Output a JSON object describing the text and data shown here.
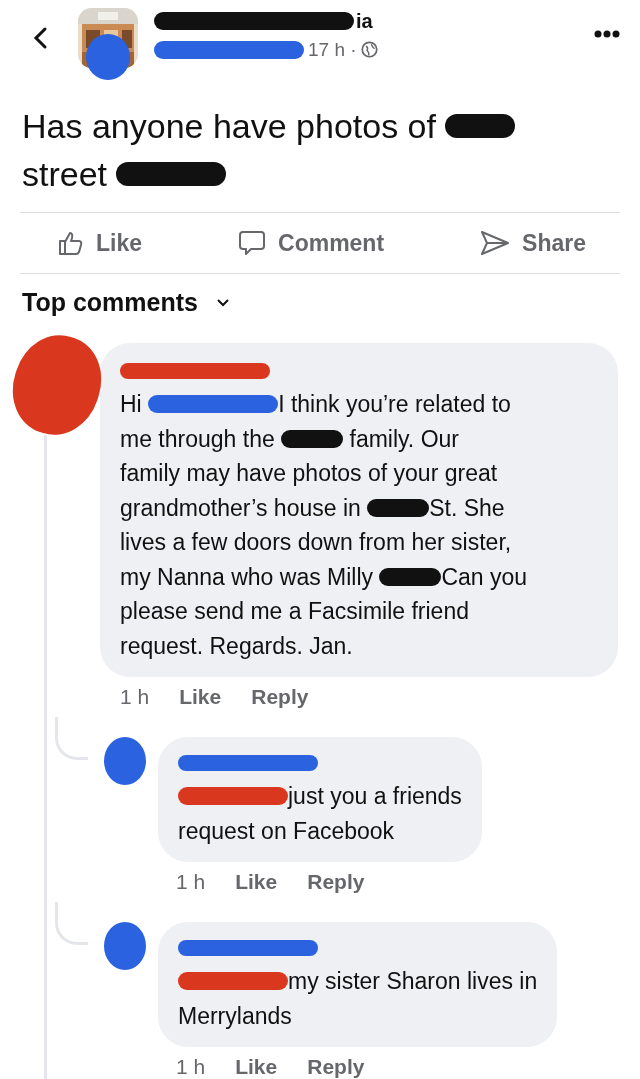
{
  "post": {
    "author": [
      {
        "kind": "redaction",
        "color": "#111111"
      },
      {
        "kind": "text",
        "text": "ia"
      }
    ],
    "time": "17 h ·",
    "lines": [
      [
        {
          "kind": "text",
          "text": "Has anyone have photos of "
        },
        {
          "kind": "redaction",
          "color": "#111111"
        }
      ],
      [
        {
          "kind": "text",
          "text": "street "
        },
        {
          "kind": "redaction",
          "color": "#111111"
        }
      ]
    ]
  },
  "actions": [
    {
      "label": "Like"
    },
    {
      "label": "Comment"
    },
    {
      "label": "Share"
    }
  ],
  "comments_header": {
    "label": "Top comments"
  },
  "comments": [
    {
      "lines": [
        [
          {
            "kind": "text",
            "text": "Hi "
          },
          {
            "kind": "redaction",
            "color": "#2a62e0"
          },
          {
            "kind": "text",
            "text": "I think you’re related to"
          }
        ],
        [
          {
            "kind": "text",
            "text": "me through the "
          },
          {
            "kind": "redaction",
            "color": "#111111"
          },
          {
            "kind": "text",
            "text": " family. Our"
          }
        ],
        [
          {
            "kind": "text",
            "text": "family may have photos of your great"
          }
        ],
        [
          {
            "kind": "text",
            "text": "grandmother’s house in "
          },
          {
            "kind": "redaction",
            "color": "#111111"
          },
          {
            "kind": "text",
            "text": "St. She"
          }
        ],
        [
          {
            "kind": "text",
            "text": "lives a few doors down from her sister,"
          }
        ],
        [
          {
            "kind": "text",
            "text": "my Nanna who was Milly "
          },
          {
            "kind": "redaction",
            "color": "#111111"
          },
          {
            "kind": "text",
            "text": "Can you"
          }
        ],
        [
          {
            "kind": "text",
            "text": "please send me a Facsimile friend"
          }
        ],
        [
          {
            "kind": "text",
            "text": "request. Regards. Jan."
          }
        ]
      ],
      "time": "1 h",
      "like": "Like",
      "reply": "Reply",
      "replies": [
        {
          "lines": [
            [
              {
                "kind": "redaction",
                "color": "#d9381e"
              },
              {
                "kind": "text",
                "text": "just you a friends"
              }
            ],
            [
              {
                "kind": "text",
                "text": "request on Facebook"
              }
            ]
          ],
          "time": "1 h",
          "like": "Like",
          "reply": "Reply"
        },
        {
          "lines": [
            [
              {
                "kind": "redaction",
                "color": "#d9381e"
              },
              {
                "kind": "text",
                "text": "my sister Sharon lives in"
              }
            ],
            [
              {
                "kind": "text",
                "text": "Merrylands"
              }
            ]
          ],
          "time": "1 h",
          "like": "Like",
          "reply": "Reply"
        }
      ]
    }
  ]
}
